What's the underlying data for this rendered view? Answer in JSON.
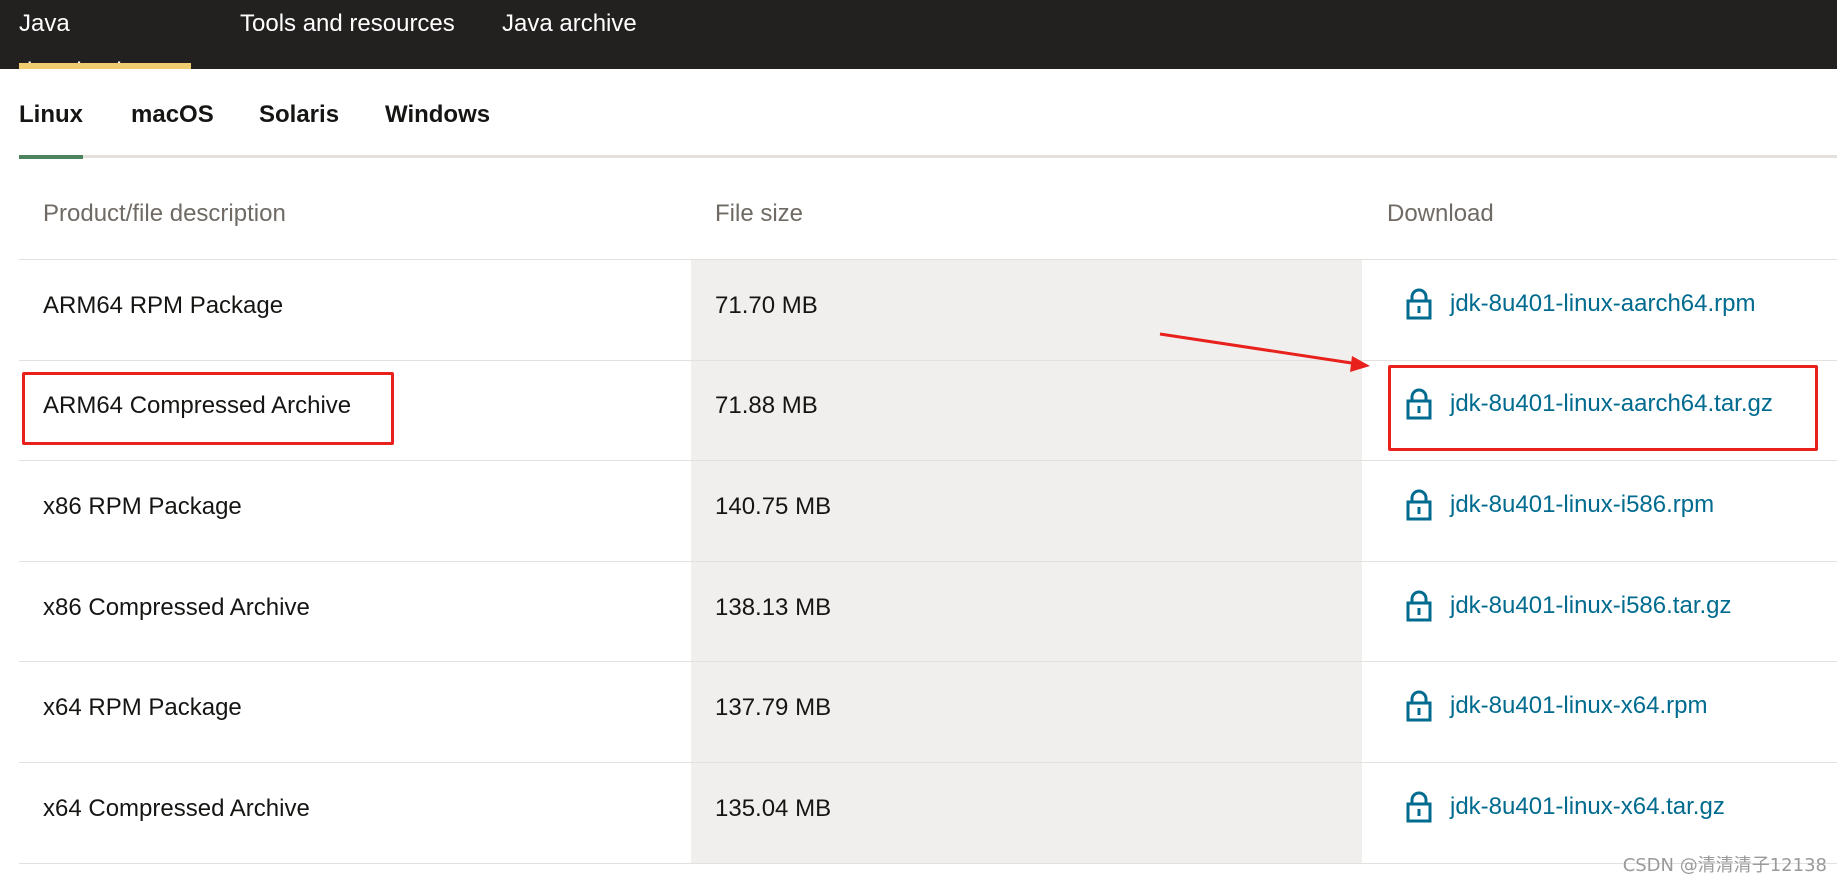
{
  "topnav": {
    "tabs": [
      "Java downloads",
      "Tools and resources",
      "Java archive"
    ],
    "active_index": 0
  },
  "os_tabs": {
    "tabs": [
      "Linux",
      "macOS",
      "Solaris",
      "Windows"
    ],
    "active_index": 0
  },
  "table": {
    "headers": [
      "Product/file description",
      "File size",
      "Download"
    ],
    "rows": [
      {
        "description": "ARM64 RPM Package",
        "size": "71.70 MB",
        "file": "jdk-8u401-linux-aarch64.rpm"
      },
      {
        "description": "ARM64 Compressed Archive",
        "size": "71.88 MB",
        "file": "jdk-8u401-linux-aarch64.tar.gz"
      },
      {
        "description": "x86 RPM Package",
        "size": "140.75 MB",
        "file": "jdk-8u401-linux-i586.rpm"
      },
      {
        "description": "x86 Compressed Archive",
        "size": "138.13 MB",
        "file": "jdk-8u401-linux-i586.tar.gz"
      },
      {
        "description": "x64 RPM Package",
        "size": "137.79 MB",
        "file": "jdk-8u401-linux-x64.rpm"
      },
      {
        "description": "x64 Compressed Archive",
        "size": "135.04 MB",
        "file": "jdk-8u401-linux-x64.tar.gz"
      }
    ]
  },
  "icons": {
    "download": "lock-icon"
  },
  "colors": {
    "nav_bg": "#232020",
    "nav_active_underline": "#f0cc71",
    "tab_active_underline": "#4c825c",
    "link": "#006b8f",
    "annotation": "#e8211d",
    "shaded_column": "#f1efed"
  },
  "watermark": "CSDN @清清清子12138"
}
